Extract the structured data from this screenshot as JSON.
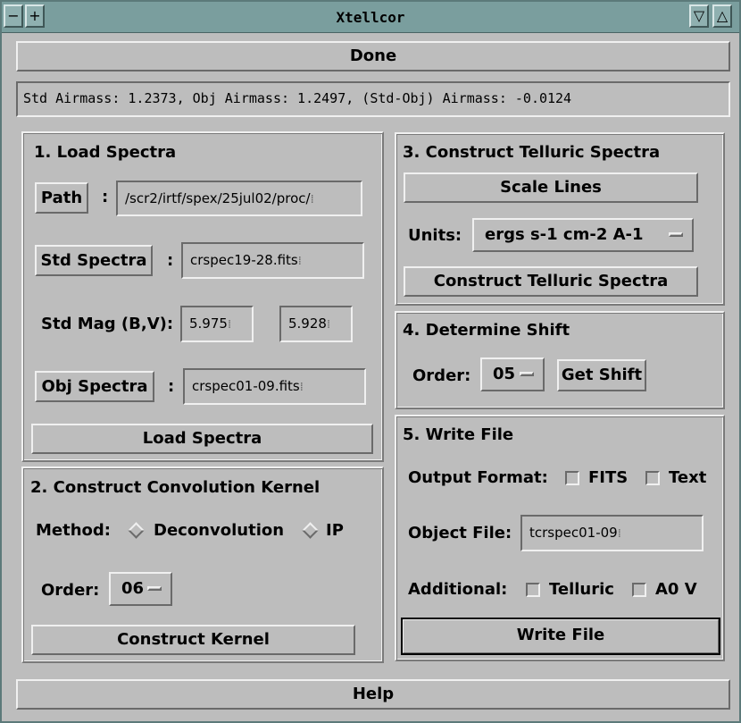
{
  "window": {
    "title": "Xtellcor"
  },
  "done_label": "Done",
  "status_text": "Std Airmass: 1.2373, Obj Airmass: 1.2497, (Std-Obj) Airmass: -0.0124",
  "load": {
    "header": "1. Load Spectra",
    "path_button": "Path",
    "path_value": "/scr2/irtf/spex/25jul02/proc/",
    "std_button": "Std Spectra",
    "std_value": "crspec19-28.fits",
    "stdmag_label": "Std Mag (B,V):",
    "mag_b": "5.975",
    "mag_v": "5.928",
    "obj_button": "Obj Spectra",
    "obj_value": "crspec01-09.fits",
    "colon": ":",
    "load_button": "Load Spectra"
  },
  "kernel": {
    "header": "2. Construct Convolution Kernel",
    "method_label": "Method:",
    "method_options": [
      "Deconvolution",
      "IP"
    ],
    "order_label": "Order:",
    "order_value": "06",
    "construct_button": "Construct Kernel"
  },
  "telluric": {
    "header": "3. Construct Telluric Spectra",
    "scale_button": "Scale Lines",
    "units_label": "Units:",
    "units_value": "ergs s-1 cm-2 A-1",
    "construct_button": "Construct Telluric Spectra"
  },
  "shift": {
    "header": "4. Determine Shift",
    "order_label": "Order:",
    "order_value": "05",
    "get_button": "Get Shift"
  },
  "write": {
    "header": "5. Write File",
    "format_label": "Output Format:",
    "fits_label": "FITS",
    "text_label": "Text",
    "object_label": "Object File:",
    "object_value": "tcrspec01-09",
    "additional_label": "Additional:",
    "telluric_label": "Telluric",
    "a0v_label": "A0 V",
    "write_button": "Write File"
  },
  "help_label": "Help"
}
